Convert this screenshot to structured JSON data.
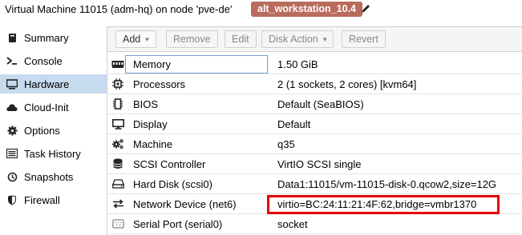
{
  "header": {
    "title": "Virtual Machine 11015 (adm-hq) on node 'pve-de'",
    "tag": "alt_workstation_10.4"
  },
  "sidebar": {
    "items": [
      {
        "label": "Summary",
        "icon": "book-icon"
      },
      {
        "label": "Console",
        "icon": "terminal-icon"
      },
      {
        "label": "Hardware",
        "icon": "monitor-icon"
      },
      {
        "label": "Cloud-Init",
        "icon": "cloud-icon"
      },
      {
        "label": "Options",
        "icon": "gear-icon"
      },
      {
        "label": "Task History",
        "icon": "list-icon"
      },
      {
        "label": "Snapshots",
        "icon": "history-icon"
      },
      {
        "label": "Firewall",
        "icon": "shield-icon"
      }
    ],
    "active": "Hardware"
  },
  "toolbar": {
    "add": "Add",
    "remove": "Remove",
    "edit": "Edit",
    "disk_action": "Disk Action",
    "revert": "Revert"
  },
  "hardware": {
    "rows": [
      {
        "name": "Memory",
        "value": "1.50 GiB",
        "icon": "memory-icon"
      },
      {
        "name": "Processors",
        "value": "2 (1 sockets, 2 cores) [kvm64]",
        "icon": "cpu-icon"
      },
      {
        "name": "BIOS",
        "value": "Default (SeaBIOS)",
        "icon": "chip-icon"
      },
      {
        "name": "Display",
        "value": "Default",
        "icon": "desktop-icon"
      },
      {
        "name": "Machine",
        "value": "q35",
        "icon": "cogs-icon"
      },
      {
        "name": "SCSI Controller",
        "value": "VirtIO SCSI single",
        "icon": "database-icon"
      },
      {
        "name": "Hard Disk (scsi0)",
        "value": "Data1:11015/vm-11015-disk-0.qcow2,size=12G",
        "icon": "hdd-icon"
      },
      {
        "name": "Network Device (net6)",
        "value": "virtio=BC:24:11:21:4F:62,bridge=vmbr1370",
        "icon": "exchange-icon"
      },
      {
        "name": "Serial Port (serial0)",
        "value": "socket",
        "icon": "serial-icon"
      }
    ]
  },
  "colors": {
    "tag_bg": "#b96b5c",
    "selected_sidebar": "#c6dbee",
    "highlight": "#e60000"
  }
}
